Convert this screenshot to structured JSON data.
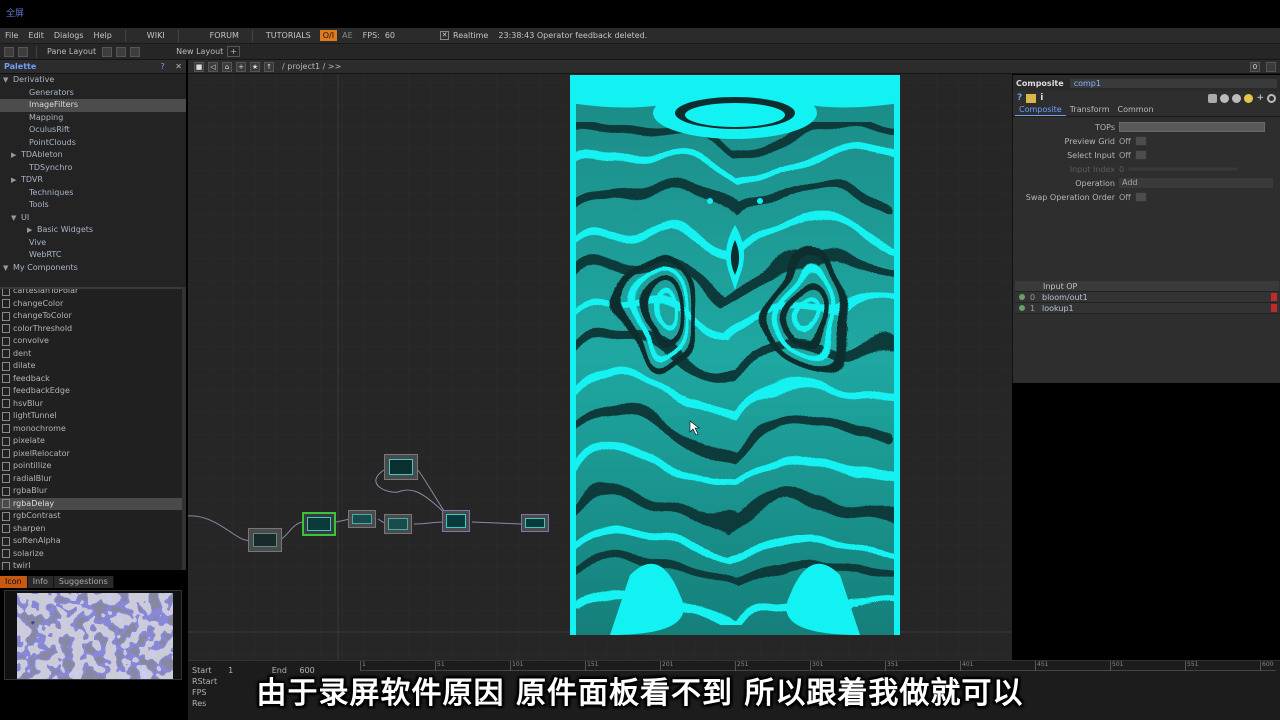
{
  "title": "全屏",
  "menu": {
    "items": [
      "File",
      "Edit",
      "Dialogs",
      "Help"
    ],
    "links": [
      "WIKI",
      "FORUM",
      "TUTORIALS"
    ],
    "badge_on": "O/I",
    "badge_ae": "AE",
    "fps_label": "FPS:",
    "fps_value": "60",
    "realtime": "Realtime",
    "status": "23:38:43 Operator feedback deleted."
  },
  "toolbar2": {
    "pane_layout": "Pane Layout",
    "new_layout": "New Layout",
    "add": "+"
  },
  "palette": {
    "title": "Palette",
    "help": "?",
    "close": "✕",
    "tree": [
      {
        "label": "Derivative",
        "indent": 0,
        "arrow": "▼"
      },
      {
        "label": "Generators",
        "indent": 2,
        "arrow": ""
      },
      {
        "label": "ImageFilters",
        "indent": 2,
        "arrow": "",
        "selected": true
      },
      {
        "label": "Mapping",
        "indent": 2,
        "arrow": ""
      },
      {
        "label": "OculusRift",
        "indent": 2,
        "arrow": ""
      },
      {
        "label": "PointClouds",
        "indent": 2,
        "arrow": ""
      },
      {
        "label": "TDAbleton",
        "indent": 1,
        "arrow": "▶"
      },
      {
        "label": "TDSynchro",
        "indent": 2,
        "arrow": ""
      },
      {
        "label": "TDVR",
        "indent": 1,
        "arrow": "▶"
      },
      {
        "label": "Techniques",
        "indent": 2,
        "arrow": ""
      },
      {
        "label": "Tools",
        "indent": 2,
        "arrow": ""
      },
      {
        "label": "UI",
        "indent": 1,
        "arrow": "▼"
      },
      {
        "label": "Basic Widgets",
        "indent": 3,
        "arrow": "▶"
      },
      {
        "label": "Vive",
        "indent": 2,
        "arrow": ""
      },
      {
        "label": "WebRTC",
        "indent": 2,
        "arrow": ""
      },
      {
        "label": "My Components",
        "indent": 0,
        "arrow": "▼"
      }
    ],
    "tox": [
      "cartesianToPolar",
      "changeColor",
      "changeToColor",
      "colorThreshold",
      "convolve",
      "dent",
      "dilate",
      "feedback",
      "feedbackEdge",
      "hsvBlur",
      "lightTunnel",
      "monochrome",
      "pixelate",
      "pixelRelocator",
      "pointillize",
      "radialBlur",
      "rgbaBlur",
      "rgbaDelay",
      "rgbContrast",
      "sharpen",
      "softenAlpha",
      "solarize",
      "twirl"
    ],
    "tox_selected": "rgbaDelay",
    "tabs": [
      "Icon",
      "Info",
      "Suggestions"
    ]
  },
  "network": {
    "path": "/ project1 / >>",
    "right_button": "0"
  },
  "params": {
    "op_type": "Composite",
    "op_name": "comp1",
    "help": "?",
    "info": "i",
    "tabs": [
      "Composite",
      "Transform",
      "Common"
    ],
    "rows": [
      {
        "label": "TOPs",
        "kind": "field",
        "value": ""
      },
      {
        "label": "Preview Grid",
        "kind": "toggle",
        "value": "Off"
      },
      {
        "label": "Select Input",
        "kind": "toggle",
        "value": "Off"
      },
      {
        "label": "Input Index",
        "kind": "dim",
        "value": "0"
      },
      {
        "label": "Operation",
        "kind": "menu",
        "value": "Add"
      },
      {
        "label": "Swap Operation Order",
        "kind": "toggle",
        "value": "Off"
      }
    ],
    "sequence_header": "Input OP",
    "sequence": [
      {
        "index": "0",
        "value": "bloom/out1"
      },
      {
        "index": "1",
        "value": "lookup1"
      }
    ]
  },
  "timeline": {
    "labels": [
      "Start",
      "RStart",
      "FPS",
      "Res"
    ],
    "start_value": "1",
    "end_label": "End",
    "end_value": "600",
    "ticks": [
      "1",
      "51",
      "101",
      "151",
      "201",
      "251",
      "301",
      "351",
      "401",
      "451",
      "501",
      "551",
      "600"
    ]
  },
  "subtitle": "由于录屏软件原因 原件面板看不到 所以跟着我做就可以",
  "colors": {
    "accent": "#e07a1f",
    "cyan": "#10f0f0",
    "teal": "#1e9e9a",
    "dark": "#0c3434",
    "node_selected": "#3ac43a"
  }
}
